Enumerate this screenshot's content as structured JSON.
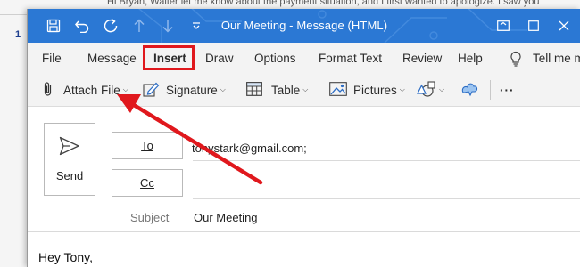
{
  "background": {
    "snippet": "Hi Bryan,   Walter let me know about the payment situation, and I first wanted to apologize. I saw you",
    "line_number": "1"
  },
  "window": {
    "title": "Our Meeting  -  Message (HTML)",
    "titlebar_color": "#2b78d4"
  },
  "menu": {
    "items": [
      "File",
      "Message",
      "Insert",
      "Draw",
      "Options",
      "Format Text",
      "Review",
      "Help"
    ],
    "tell_me": "Tell me m",
    "highlighted": "Insert",
    "highlight_color": "#e0181d"
  },
  "toolbar": {
    "attach_file": "Attach File",
    "signature": "Signature",
    "table": "Table",
    "pictures": "Pictures",
    "more": "···"
  },
  "compose": {
    "send": "Send",
    "to_label": "To",
    "cc_label": "Cc",
    "to_value": "tonystark@gmail.com;",
    "subject_label": "Subject",
    "subject_value": "Our Meeting",
    "body": "Hey Tony,"
  },
  "annotation": {
    "arrow_color": "#e0181d",
    "icon": "red-arrow-pointing-to-attach-file"
  }
}
